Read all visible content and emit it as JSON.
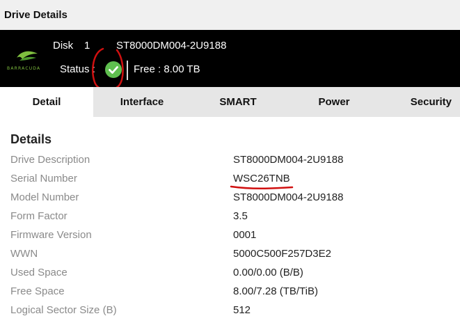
{
  "window": {
    "title": "Drive Details"
  },
  "drive": {
    "brand_logo_text": "BARRACUDA",
    "disk_label": "Disk",
    "disk_number": "1",
    "model": "ST8000DM004-2U9188",
    "status_label": "Status :",
    "status_icon": "check-circle-icon",
    "status_color": "#5fbf4f",
    "free_label": "Free : 8.00 TB"
  },
  "tabs": [
    {
      "label": "Detail",
      "active": true
    },
    {
      "label": "Interface",
      "active": false
    },
    {
      "label": "SMART",
      "active": false
    },
    {
      "label": "Power",
      "active": false
    },
    {
      "label": "Security",
      "active": false
    }
  ],
  "details": {
    "title": "Details",
    "rows": [
      {
        "label": "Drive Description",
        "value": "ST8000DM004-2U9188"
      },
      {
        "label": "Serial Number",
        "value": "WSC26TNB"
      },
      {
        "label": "Model Number",
        "value": "ST8000DM004-2U9188"
      },
      {
        "label": "Form Factor",
        "value": "3.5"
      },
      {
        "label": "Firmware Version",
        "value": "0001"
      },
      {
        "label": "WWN",
        "value": "5000C500F257D3E2"
      },
      {
        "label": "Used Space",
        "value": "0.00/0.00 (B/B)"
      },
      {
        "label": "Free Space",
        "value": "8.00/7.28 (TB/TiB)"
      },
      {
        "label": "Logical Sector Size (B)",
        "value": "512"
      }
    ]
  },
  "annotations": {
    "color": "#d01010"
  }
}
